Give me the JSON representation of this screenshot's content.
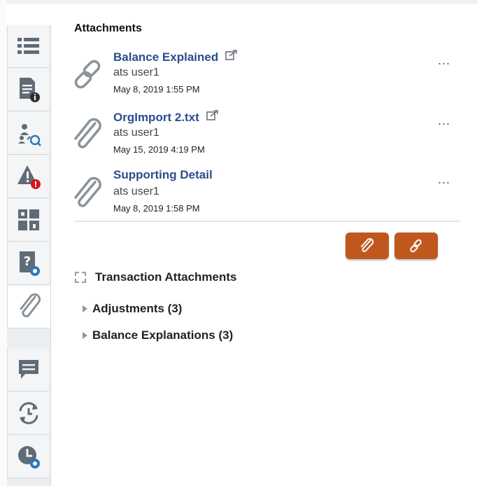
{
  "panel": {
    "title": "Attachments"
  },
  "attachments": [
    {
      "name": "Balance Explained",
      "type": "link-icon",
      "has_external": true,
      "user": "ats user1",
      "date": "May 8, 2019 1:55 PM",
      "more": "..."
    },
    {
      "name": "OrgImport 2.txt",
      "type": "paperclip-icon",
      "has_external": true,
      "user": "ats user1",
      "date": "May 15, 2019 4:19 PM",
      "more": "..."
    },
    {
      "name": "Supporting Detail",
      "type": "paperclip-icon",
      "has_external": false,
      "user": "ats user1",
      "date": "May 8, 2019 1:58 PM",
      "more": "..."
    }
  ],
  "actions": {
    "attach_file_icon": "paperclip-icon",
    "attach_link_icon": "link-icon",
    "accent": "#c0581e"
  },
  "transaction_attachments": {
    "title": "Transaction Attachments",
    "items": [
      {
        "label": "Adjustments (3)"
      },
      {
        "label": "Balance Explanations (3)"
      }
    ]
  },
  "sidebar": {
    "tabs": [
      "list-icon",
      "document-info-icon",
      "users-search-icon",
      "alert-icon",
      "dashboard-icon",
      "question-doc-icon",
      "paperclip-icon",
      "comment-icon",
      "history-icon",
      "clock-icon"
    ],
    "active": "paperclip-icon"
  },
  "colors": {
    "link": "#2b4d8e",
    "icon_gray": "#5f6b77",
    "badge_red": "#d8141c",
    "badge_blue": "#2f76c2"
  }
}
